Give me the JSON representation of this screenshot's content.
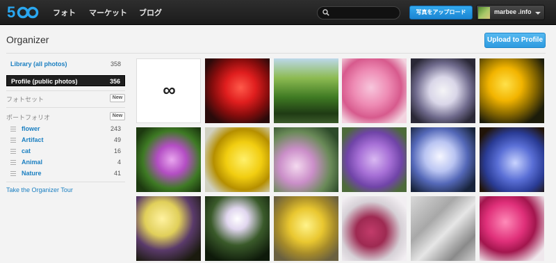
{
  "nav": {
    "items": [
      "フォト",
      "マーケット",
      "ブログ"
    ],
    "upload_label": "写真をアップロード",
    "search_placeholder": "",
    "username": "marbee .info"
  },
  "header": {
    "title": "Organizer",
    "upload_profile_label": "Upload to Profile"
  },
  "sidebar": {
    "library": {
      "label": "Library (all photos)",
      "count": "358"
    },
    "profile": {
      "label": "Profile (public photos)",
      "count": "356"
    },
    "sets_label": "フォトセット",
    "portfolio_label": "ポートフォリオ",
    "new_label": "New",
    "portfolio": [
      {
        "name": "flower",
        "count": "243"
      },
      {
        "name": "Artifact",
        "count": "49"
      },
      {
        "name": "cat",
        "count": "16"
      },
      {
        "name": "Animal",
        "count": "4"
      },
      {
        "name": "Nature",
        "count": "41"
      }
    ],
    "tour_link": "Take the Organizer Tour"
  },
  "grid": {
    "add_symbol": "∞",
    "photos": [
      "red-poppy",
      "green-trees-pond",
      "pink-cherry-blossoms",
      "white-daisies",
      "yellow-poppies",
      "pink-aster",
      "yellow-daisy",
      "purple-tulip",
      "lilac-flowers",
      "white-iris",
      "blue-bluebells",
      "yellow-iris",
      "small-wildflowers",
      "yellow-flowers",
      "red-buds",
      "bare-branches",
      "pink-tulip"
    ]
  },
  "colors": {
    "accent": "#1a7fc1",
    "upload_button": "#2196e3",
    "topbar": "#222222"
  }
}
